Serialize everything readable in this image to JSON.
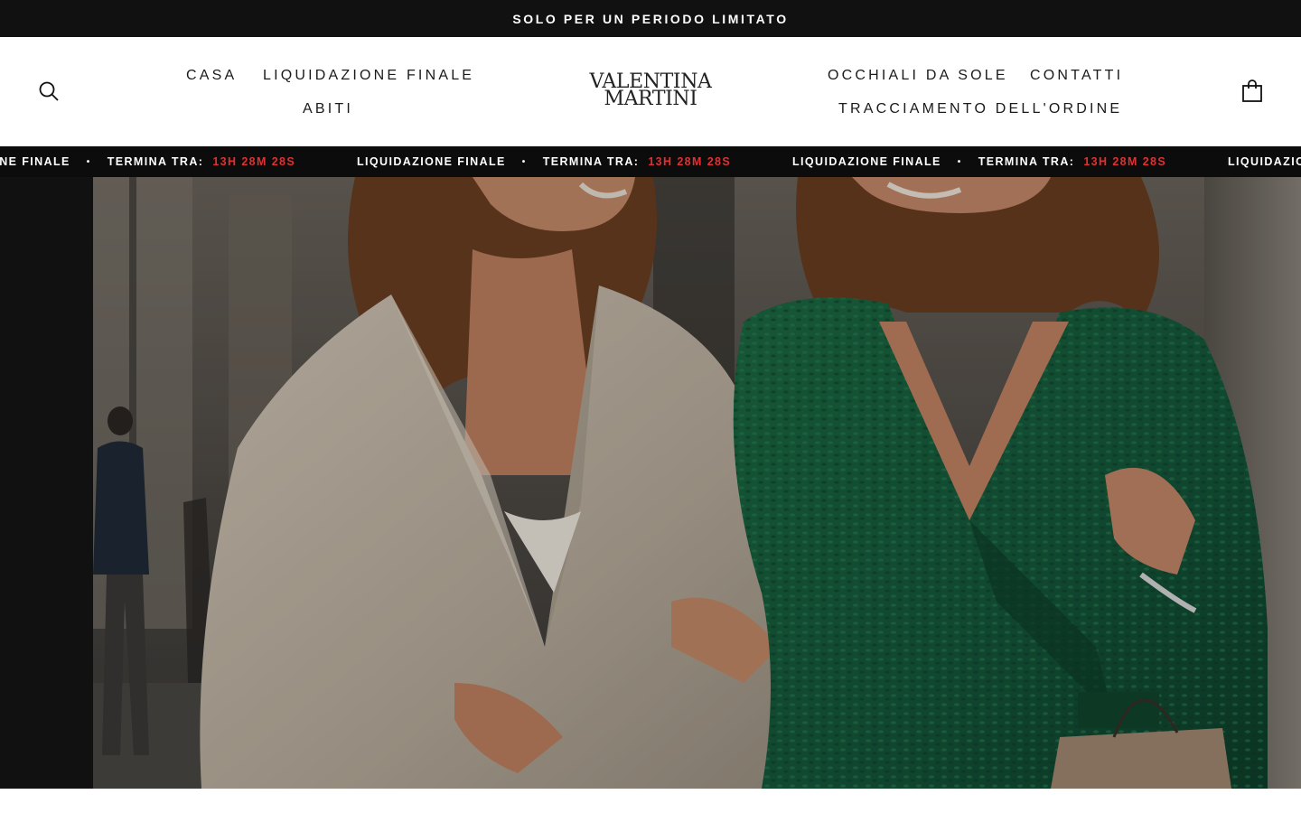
{
  "announcement": {
    "text": "SOLO PER UN PERIODO LIMITATO"
  },
  "header": {
    "logo_line1": "VALENTINA",
    "logo_line2": "MARTINI",
    "nav_left": [
      "CASA",
      "LIQUIDAZIONE FINALE",
      "ABITI"
    ],
    "nav_right": [
      "OCCHIALI DA SOLE",
      "CONTATTI",
      "TRACCIAMENTO DELL'ORDINE"
    ],
    "icons": {
      "search": "search-icon",
      "cart": "shopping-bag-icon"
    }
  },
  "ticker": {
    "sale_label": "LIQUIDAZIONE FINALE",
    "separator": "•",
    "ends_label": "TERMINA TRA:",
    "countdown": "13H 28M 28S"
  },
  "hero": {
    "image_subject": "two women walking arm in arm on a city street, one in a beige blazer, one in a green wrap dress",
    "overlay_color": "#111111"
  },
  "colors": {
    "bar": "#111111",
    "countdown": "#e03131",
    "background": "#ffffff"
  }
}
